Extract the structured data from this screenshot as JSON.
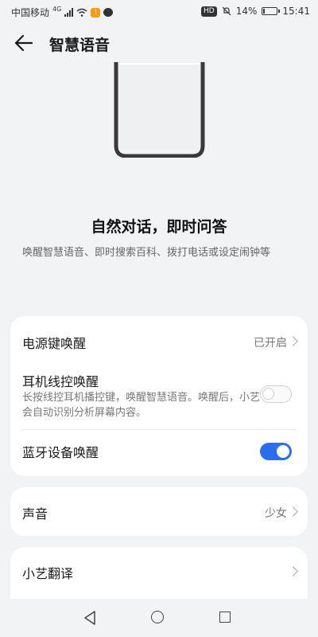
{
  "status_bar": {
    "carrier": "中国移动",
    "network": "4G",
    "battery_percent": "14%",
    "battery_level": 0.14,
    "time": "15:41",
    "hd": "HD"
  },
  "header": {
    "title": "智慧语音",
    "back_icon": "arrow-left-icon"
  },
  "intro": {
    "headline": "自然对话，即时问答",
    "description": "唤醒智慧语音、即时搜索百科、拨打电话或设定闹钟等"
  },
  "wake_card": {
    "power_key": {
      "label": "电源键唤醒",
      "value": "已开启"
    },
    "headset": {
      "label": "耳机线控唤醒",
      "subtitle": "长按线控耳机播控键，唤醒智慧语音。唤醒后，小艺会自动识别分析屏幕内容。",
      "enabled": false
    },
    "bluetooth": {
      "label": "蓝牙设备唤醒",
      "enabled": true
    }
  },
  "voice_card": {
    "label": "声音",
    "value": "少女"
  },
  "translate_card": {
    "label": "小艺翻译"
  },
  "colors": {
    "accent": "#2a6ef0",
    "background": "#f1f3f5",
    "card": "#ffffff"
  }
}
